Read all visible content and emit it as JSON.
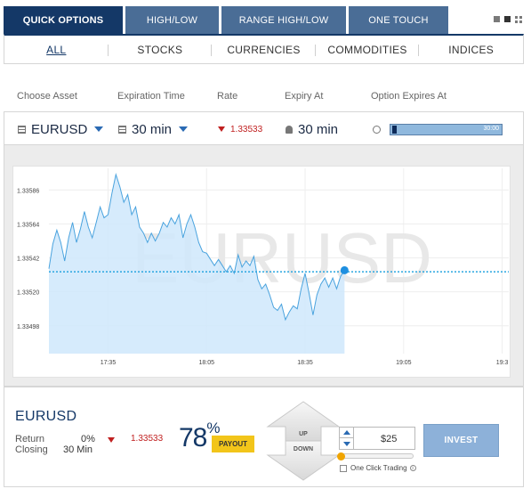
{
  "tabs": [
    {
      "label": "QUICK OPTIONS",
      "active": true
    },
    {
      "label": "HIGH/LOW",
      "active": false
    },
    {
      "label": "RANGE HIGH/LOW",
      "active": false
    },
    {
      "label": "ONE TOUCH",
      "active": false
    }
  ],
  "categories": [
    "ALL",
    "STOCKS",
    "CURRENCIES",
    "COMMODITIES",
    "INDICES"
  ],
  "active_category": "ALL",
  "columns": {
    "choose_asset": "Choose Asset",
    "expiration_time": "Expiration Time",
    "rate": "Rate",
    "expiry_at": "Expiry At",
    "option_expires_at": "Option Expires At"
  },
  "asset_row": {
    "asset": "EURUSD",
    "expiration": "30 min",
    "rate": "1.33533",
    "expiry_at": "30 min",
    "countdown": "30:00",
    "countdown_progress": 0.04
  },
  "chart": {
    "watermark": "EURUSD",
    "y_ticks": [
      "1.33586",
      "1.33564",
      "1.33542",
      "1.33520",
      "1.33498"
    ],
    "x_ticks": [
      "17:35",
      "18:05",
      "18:35",
      "19:05",
      "19:3"
    ],
    "current_level": "1.33533",
    "colors": {
      "line": "#4aa3de",
      "fill": "#cfe8fb",
      "current": "#1e8fe0"
    }
  },
  "chart_data": {
    "type": "area",
    "ylim": [
      1.3348,
      1.336
    ],
    "y_tick_values": [
      1.33586,
      1.33564,
      1.33542,
      1.3352,
      1.33498
    ],
    "x_tick_minutes": [
      35,
      65,
      95,
      125,
      155
    ],
    "series": [
      {
        "points": [
          [
            17.0,
            1.33535
          ],
          [
            18.2,
            1.33551
          ],
          [
            19.4,
            1.3356
          ],
          [
            20.6,
            1.33552
          ],
          [
            21.8,
            1.3354
          ],
          [
            23.0,
            1.33555
          ],
          [
            24.2,
            1.33565
          ],
          [
            25.4,
            1.33552
          ],
          [
            26.6,
            1.33561
          ],
          [
            27.8,
            1.33572
          ],
          [
            29.0,
            1.33562
          ],
          [
            30.2,
            1.33555
          ],
          [
            31.4,
            1.33565
          ],
          [
            32.6,
            1.33575
          ],
          [
            33.8,
            1.33568
          ],
          [
            35.0,
            1.3357
          ],
          [
            36.2,
            1.33584
          ],
          [
            37.4,
            1.33596
          ],
          [
            38.6,
            1.33588
          ],
          [
            39.8,
            1.33578
          ],
          [
            41.0,
            1.33583
          ],
          [
            42.2,
            1.3357
          ],
          [
            43.4,
            1.33575
          ],
          [
            44.6,
            1.33562
          ],
          [
            45.8,
            1.33558
          ],
          [
            47.0,
            1.33552
          ],
          [
            48.2,
            1.33558
          ],
          [
            49.4,
            1.33553
          ],
          [
            50.6,
            1.33558
          ],
          [
            51.8,
            1.33565
          ],
          [
            53.0,
            1.33562
          ],
          [
            54.2,
            1.33568
          ],
          [
            55.4,
            1.33564
          ],
          [
            56.6,
            1.3357
          ],
          [
            57.8,
            1.33555
          ],
          [
            59.0,
            1.33564
          ],
          [
            60.2,
            1.3357
          ],
          [
            61.4,
            1.33562
          ],
          [
            62.6,
            1.33552
          ],
          [
            63.8,
            1.33546
          ],
          [
            65.0,
            1.33545
          ],
          [
            66.2,
            1.33541
          ],
          [
            67.4,
            1.33537
          ],
          [
            68.6,
            1.33541
          ],
          [
            69.8,
            1.33537
          ],
          [
            71.0,
            1.33533
          ],
          [
            72.2,
            1.33537
          ],
          [
            73.4,
            1.33532
          ],
          [
            74.6,
            1.33544
          ],
          [
            75.8,
            1.33536
          ],
          [
            77.0,
            1.3354
          ],
          [
            78.2,
            1.33537
          ],
          [
            79.4,
            1.33543
          ],
          [
            80.6,
            1.33528
          ],
          [
            81.8,
            1.33522
          ],
          [
            83.0,
            1.33525
          ],
          [
            84.2,
            1.33518
          ],
          [
            85.4,
            1.3351
          ],
          [
            86.6,
            1.33508
          ],
          [
            87.8,
            1.33512
          ],
          [
            89.0,
            1.33502
          ],
          [
            90.2,
            1.33507
          ],
          [
            91.4,
            1.33511
          ],
          [
            92.6,
            1.33509
          ],
          [
            93.8,
            1.33522
          ],
          [
            95.0,
            1.33532
          ],
          [
            96.2,
            1.33519
          ],
          [
            97.4,
            1.33505
          ],
          [
            98.6,
            1.33518
          ],
          [
            99.8,
            1.33525
          ],
          [
            101.0,
            1.33529
          ],
          [
            102.2,
            1.33523
          ],
          [
            103.4,
            1.33529
          ],
          [
            104.6,
            1.33522
          ],
          [
            105.8,
            1.3353
          ],
          [
            107.0,
            1.33534
          ]
        ]
      }
    ]
  },
  "trade": {
    "asset": "EURUSD",
    "return_label": "Return",
    "return_value": "0%",
    "closing_label": "Closing",
    "closing_value": "30 Min",
    "rate": "1.33533",
    "payout_number": "78",
    "payout_symbol": "%",
    "payout_label": "PAYOUT",
    "up_label": "UP",
    "down_label": "DOWN",
    "amount": "$25",
    "one_click_label": "One Click Trading",
    "invest_label": "INVEST"
  }
}
